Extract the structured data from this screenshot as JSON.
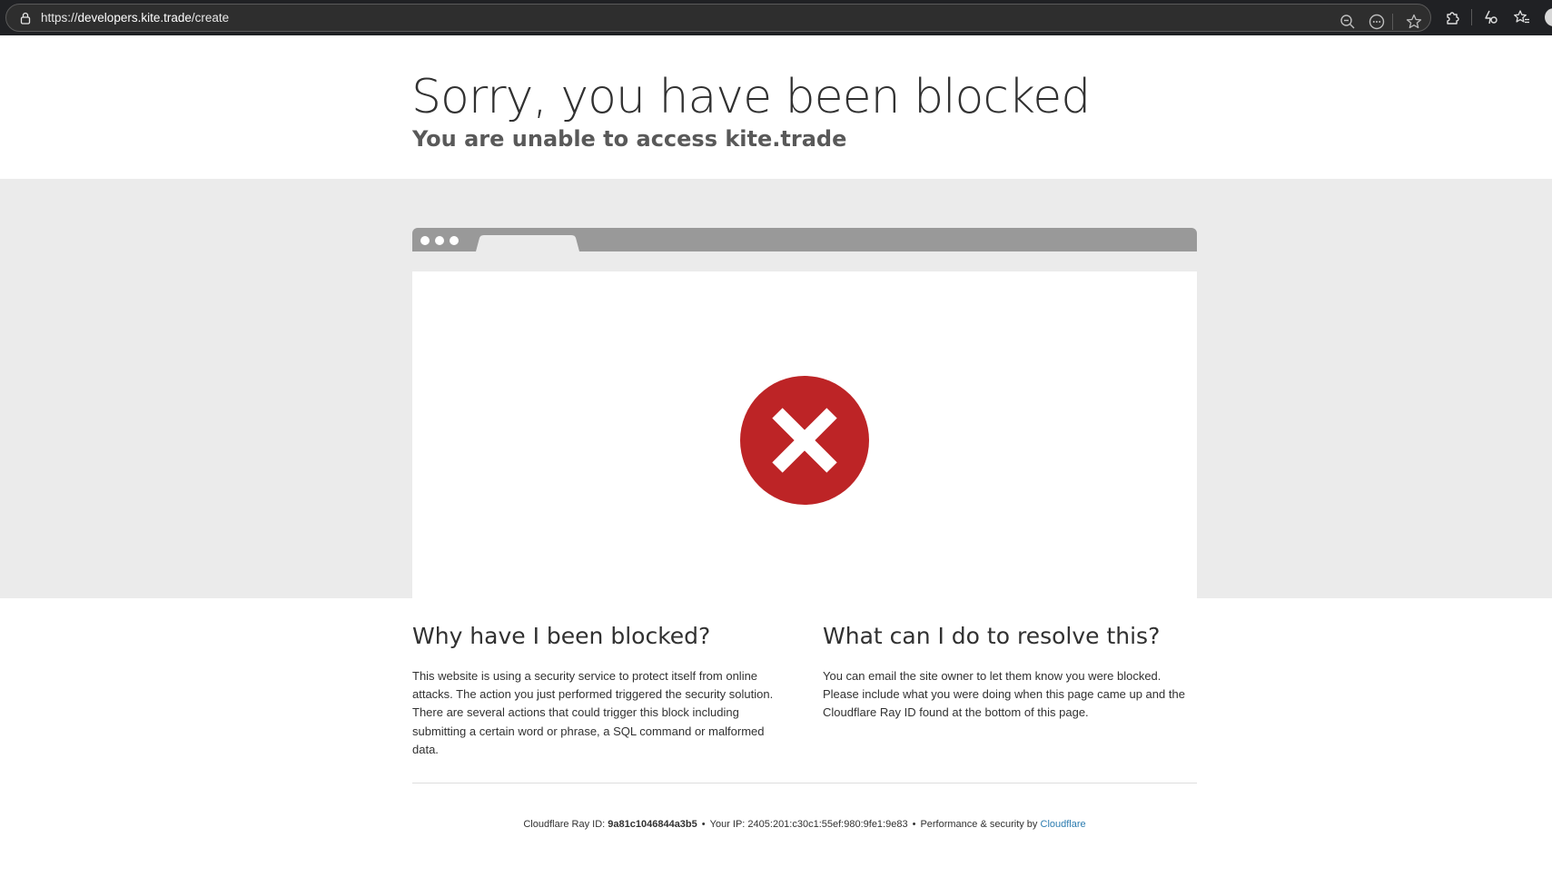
{
  "browser": {
    "url_scheme": "https://",
    "url_host": "developers.kite.trade",
    "url_path": "/create",
    "icons": [
      "lock-icon",
      "zoom-out-icon",
      "more-actions-icon",
      "favorite-star-icon",
      "extensions-icon",
      "browser-essentials-icon",
      "favorites-collection-icon",
      "profile-avatar"
    ]
  },
  "header": {
    "title": "Sorry, you have been blocked",
    "subtitle": "You are unable to access kite.trade"
  },
  "illustration": {
    "icon": "error-x-icon",
    "accent_color": "#bd2426"
  },
  "why": {
    "heading": "Why have I been blocked?",
    "body": "This website is using a security service to protect itself from online attacks. The action you just performed triggered the security solution. There are several actions that could trigger this block including submitting a certain word or phrase, a SQL command or malformed data."
  },
  "resolve": {
    "heading": "What can I do to resolve this?",
    "body": "You can email the site owner to let them know you were blocked. Please include what you were doing when this page came up and the Cloudflare Ray ID found at the bottom of this page."
  },
  "footer": {
    "ray_label": "Cloudflare Ray ID:",
    "ray_id": "9a81c1046844a3b5",
    "ip_label": "Your IP:",
    "ip_value": "2405:201:c30c1:55ef:980:9fe1:9e83",
    "performance_label": "Performance & security by",
    "cloudflare_link": "Cloudflare",
    "bullet": "•",
    "link_color": "#2c7cb0"
  }
}
